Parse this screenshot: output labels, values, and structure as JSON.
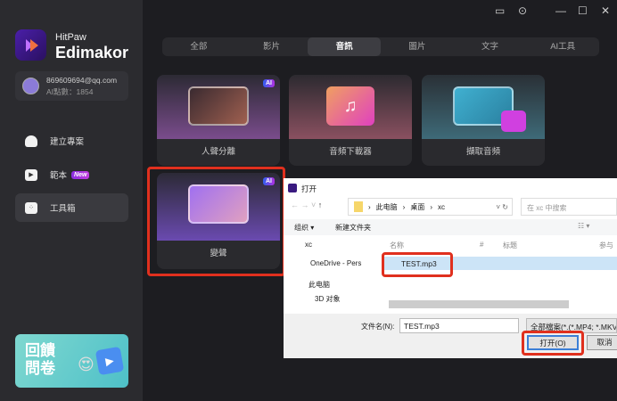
{
  "app": {
    "brand_top": "HitPaw",
    "brand_name": "Edimakor"
  },
  "account": {
    "email": "869609694@qq.com",
    "points": "AI點數：1854"
  },
  "sidebar": {
    "items": [
      {
        "label": "建立專案"
      },
      {
        "label": "範本",
        "badge": "New"
      },
      {
        "label": "工具箱"
      }
    ]
  },
  "banner": {
    "text": "回饋問卷"
  },
  "window_controls": [
    "feedback-icon",
    "settings-icon",
    "minimize",
    "maximize",
    "close"
  ],
  "tabs": [
    {
      "label": "全部"
    },
    {
      "label": "影片"
    },
    {
      "label": "音訊",
      "active": true
    },
    {
      "label": "圖片"
    },
    {
      "label": "文字"
    },
    {
      "label": "AI工具"
    }
  ],
  "cards": [
    {
      "label": "人聲分離",
      "ai": "AI"
    },
    {
      "label": "音頻下載器"
    },
    {
      "label": "擷取音頻"
    },
    {
      "label": "變聲",
      "ai": "AI"
    }
  ],
  "dialog": {
    "title": "打开",
    "path": [
      "此电脑",
      "桌面",
      "xc"
    ],
    "search_placeholder": "在 xc 中搜索",
    "organize": "组织 ▾",
    "new_folder": "新建文件夹",
    "left_items": [
      "xc",
      "OneDrive - Pers",
      "此电脑",
      "3D 对象"
    ],
    "columns": [
      "名称",
      "#",
      "标题",
      "参与"
    ],
    "files": [
      "TEST.mp3"
    ],
    "filename_label": "文件名(N):",
    "filename_value": "TEST.mp3",
    "filetype": "全部檔案(*.(*.MP4; *.MKV;",
    "open": "打开(O)",
    "cancel": "取消"
  }
}
